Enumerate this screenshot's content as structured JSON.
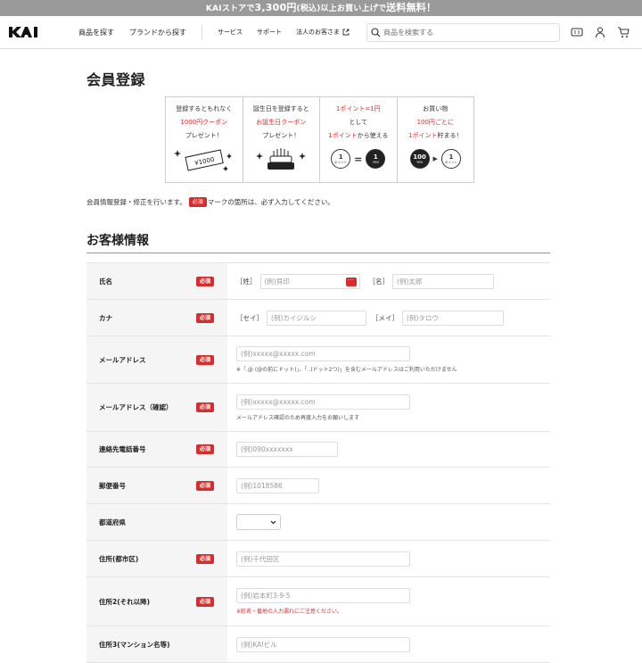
{
  "banner": {
    "pre": "KAIストアで",
    "amount": "3,300円",
    "mid": "(税込)以上お買い上げで",
    "free": "送料無料！"
  },
  "header": {
    "logo": "KAI",
    "nav": [
      "商品を探す",
      "ブランドから探す"
    ],
    "nav_small": [
      "サービス",
      "サポート",
      "法人のお客さま"
    ],
    "search_placeholder": "商品を検索する"
  },
  "page_title": "会員登録",
  "benefits": [
    {
      "l1": "登録するともれなく",
      "l2": "1000円クーポン",
      "l3": "プレゼント！",
      "icon_text": "¥1000"
    },
    {
      "l1": "誕生日を登録すると",
      "l2": "お誕生日クーポン",
      "l3": "プレゼント！"
    },
    {
      "l1": "1ポイント=1円",
      "l2": "として",
      "l3a": "1ポイント",
      "l3b": "から使える",
      "c1": "1",
      "c1s": "ポイント",
      "eq": "=",
      "c2": "1",
      "c2s": "YEN"
    },
    {
      "l1": "お買い物",
      "l2": "100円ごとに",
      "l3a": "1ポイント",
      "l3b": "貯まる！",
      "c1": "100",
      "c1s": "YEN",
      "arrow": "▶",
      "c2": "1",
      "c2s": "ポイント"
    }
  ],
  "notice": {
    "pre": "会員情報登録・修正を行います。",
    "req": "必須",
    "post": "マークの箇所は、必ず入力してください。"
  },
  "section_title": "お客様情報",
  "req_label": "必須",
  "form": {
    "name": {
      "label": "氏名",
      "sei": "［姓］",
      "sei_ph": "(例)貝印",
      "mei": "［名］",
      "mei_ph": "(例)太郎"
    },
    "kana": {
      "label": "カナ",
      "sei": "［セイ］",
      "sei_ph": "(例)カイジルシ",
      "mei": "［メイ］",
      "mei_ph": "(例)タロウ"
    },
    "email": {
      "label": "メールアドレス",
      "ph": "(例)xxxxx@xxxxx.com",
      "hint": "※「.@ (@の前にドット)」、「..(ドット2つ)」を含むメールアドレスはご利用いただけません"
    },
    "email2": {
      "label": "メールアドレス（確認）",
      "ph": "(例)xxxxx@xxxxx.com",
      "hint": "メールアドレス確認のため再度入力をお願いします"
    },
    "tel": {
      "label": "連絡先電話番号",
      "ph": "(例)090xxxxxxx"
    },
    "zip": {
      "label": "郵便番号",
      "ph": "(例)1018586"
    },
    "pref": {
      "label": "都道府県"
    },
    "addr1": {
      "label": "住所(都市区)",
      "ph": "(例)千代田区"
    },
    "addr2": {
      "label": "住所2(それ以降)",
      "ph": "(例)岩本町3-9-5",
      "hint": "※町名・番地の入力漏れにご注意ください。"
    },
    "addr3": {
      "label": "住所3(マンション名等)",
      "ph": "(例)KAIビル"
    }
  }
}
